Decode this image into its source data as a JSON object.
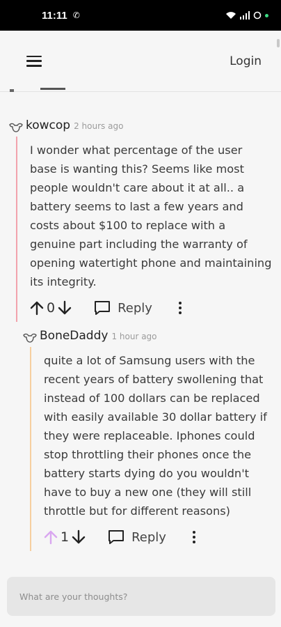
{
  "status_bar": {
    "time": "11:11"
  },
  "header": {
    "login_label": "Login"
  },
  "comments": [
    {
      "author": "kowcop",
      "time_ago": "2 hours ago",
      "text": "I wonder what percentage of the user base is wanting this? Seems like most people wouldn't care about it at all.. a battery seems to last a few years and costs about $100 to replace with a genuine part including the warranty of opening watertight phone and maintaining its integrity.",
      "score": "0",
      "reply_label": "Reply"
    },
    {
      "author": "BoneDaddy",
      "time_ago": "1 hour ago",
      "text": "quite a lot of Samsung users with the recent years of battery swollening that instead of 100 dollars can be replaced with easily available 30 dollar battery if they were replaceable. Iphones could stop throttling their phones once the battery starts dying do you wouldn't have to buy a new one (they will still throttle but for different reasons)",
      "score": "1",
      "reply_label": "Reply"
    }
  ],
  "composer": {
    "placeholder": "What are your thoughts?"
  },
  "colors": {
    "thread_line_level1": "#f2a3ad",
    "thread_line_level2": "#f6cf9f",
    "upvote_active": "#d9a6f0"
  }
}
